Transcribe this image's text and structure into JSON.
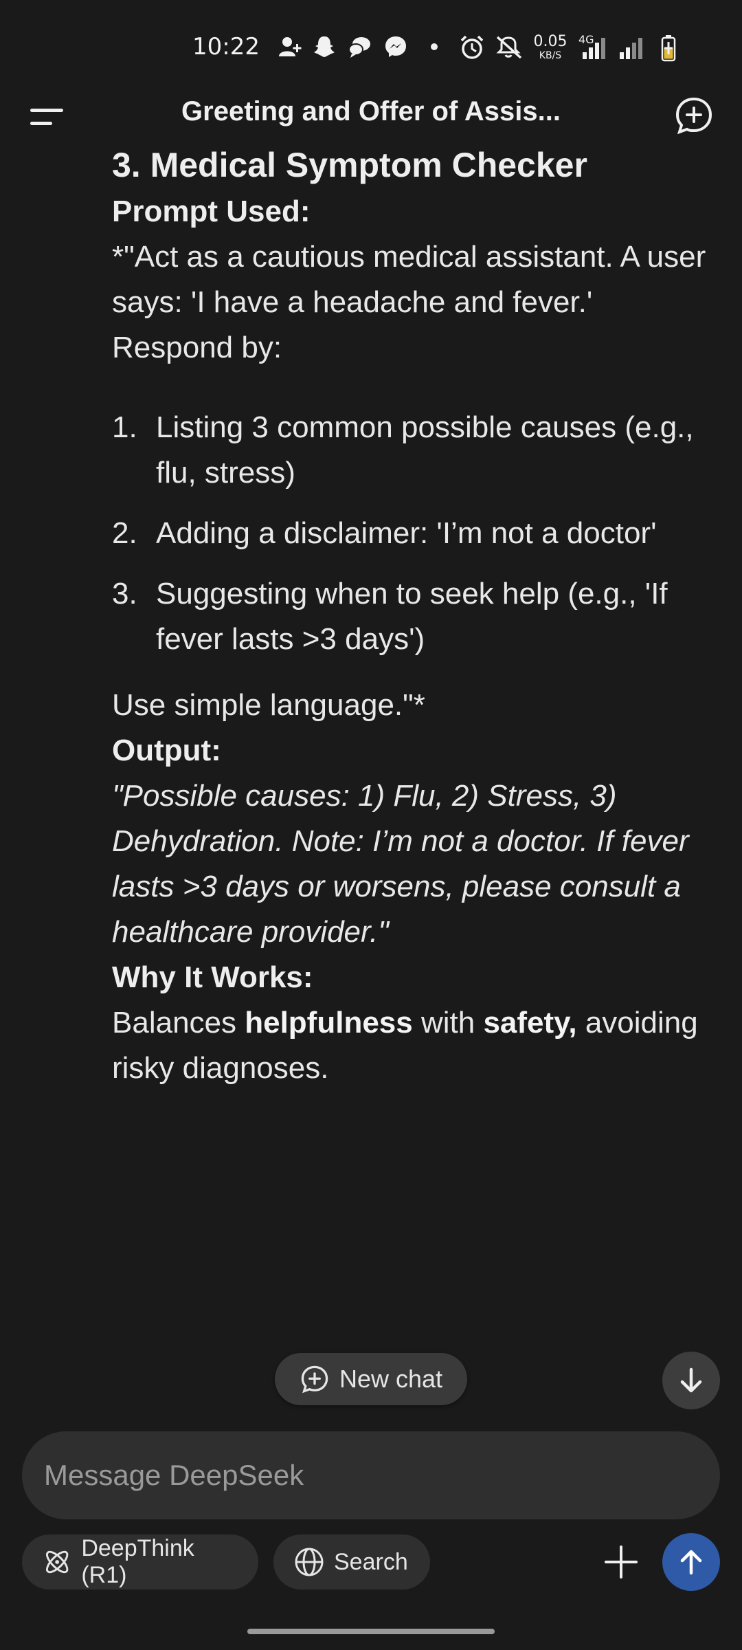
{
  "status_bar": {
    "time": "10:22",
    "net_rate": "0.05",
    "net_unit": "KB/S",
    "network_type": "4G",
    "icons": [
      "add-contact-icon",
      "snapchat-icon",
      "chat-bubble-icon",
      "messenger-icon",
      "dot-icon",
      "alarm-icon",
      "mute-icon",
      "signal-icon",
      "signal-icon",
      "battery-charging-icon"
    ]
  },
  "header": {
    "title": "Greeting and Offer of Assis..."
  },
  "message": {
    "section_heading": "3.  Medical Symptom Checker",
    "prompt_label": "Prompt Used:",
    "prompt_intro": "*\"Act as a cautious medical assistant.  A user says: 'I have a headache and fever.' Respond by:",
    "list": [
      {
        "num": "1.",
        "text": "Listing 3 common possible causes (e.g., flu, stress)"
      },
      {
        "num": "2.",
        "text": "Adding a disclaimer: 'I’m not a doctor'"
      },
      {
        "num": "3.",
        "text": "Suggesting when to seek help (e.g., 'If fever lasts >3 days')"
      }
    ],
    "prompt_outro": "Use simple language.\"*",
    "output_label": "Output:",
    "output_text": "\"Possible causes: 1) Flu, 2) Stress, 3) Dehydration.  Note: I’m not a doctor.  If fever lasts >3 days or worsens, please consult a healthcare provider.\"",
    "why_label": "Why It Works:",
    "why_prefix": "Balances ",
    "why_bold1": "helpfulness",
    "why_mid": " with ",
    "why_bold2": "safety,",
    "why_suffix": " avoiding risky diagnoses."
  },
  "floating": {
    "new_chat_label": "New chat"
  },
  "composer": {
    "placeholder": "Message DeepSeek",
    "value": "",
    "deepthink_label": "DeepThink (R1)",
    "search_label": "Search"
  },
  "colors": {
    "background": "#1a1a1a",
    "surface": "#2f2f2f",
    "accent": "#2e5aa8",
    "text": "#e8e8e8",
    "placeholder": "#9a9a9a"
  }
}
